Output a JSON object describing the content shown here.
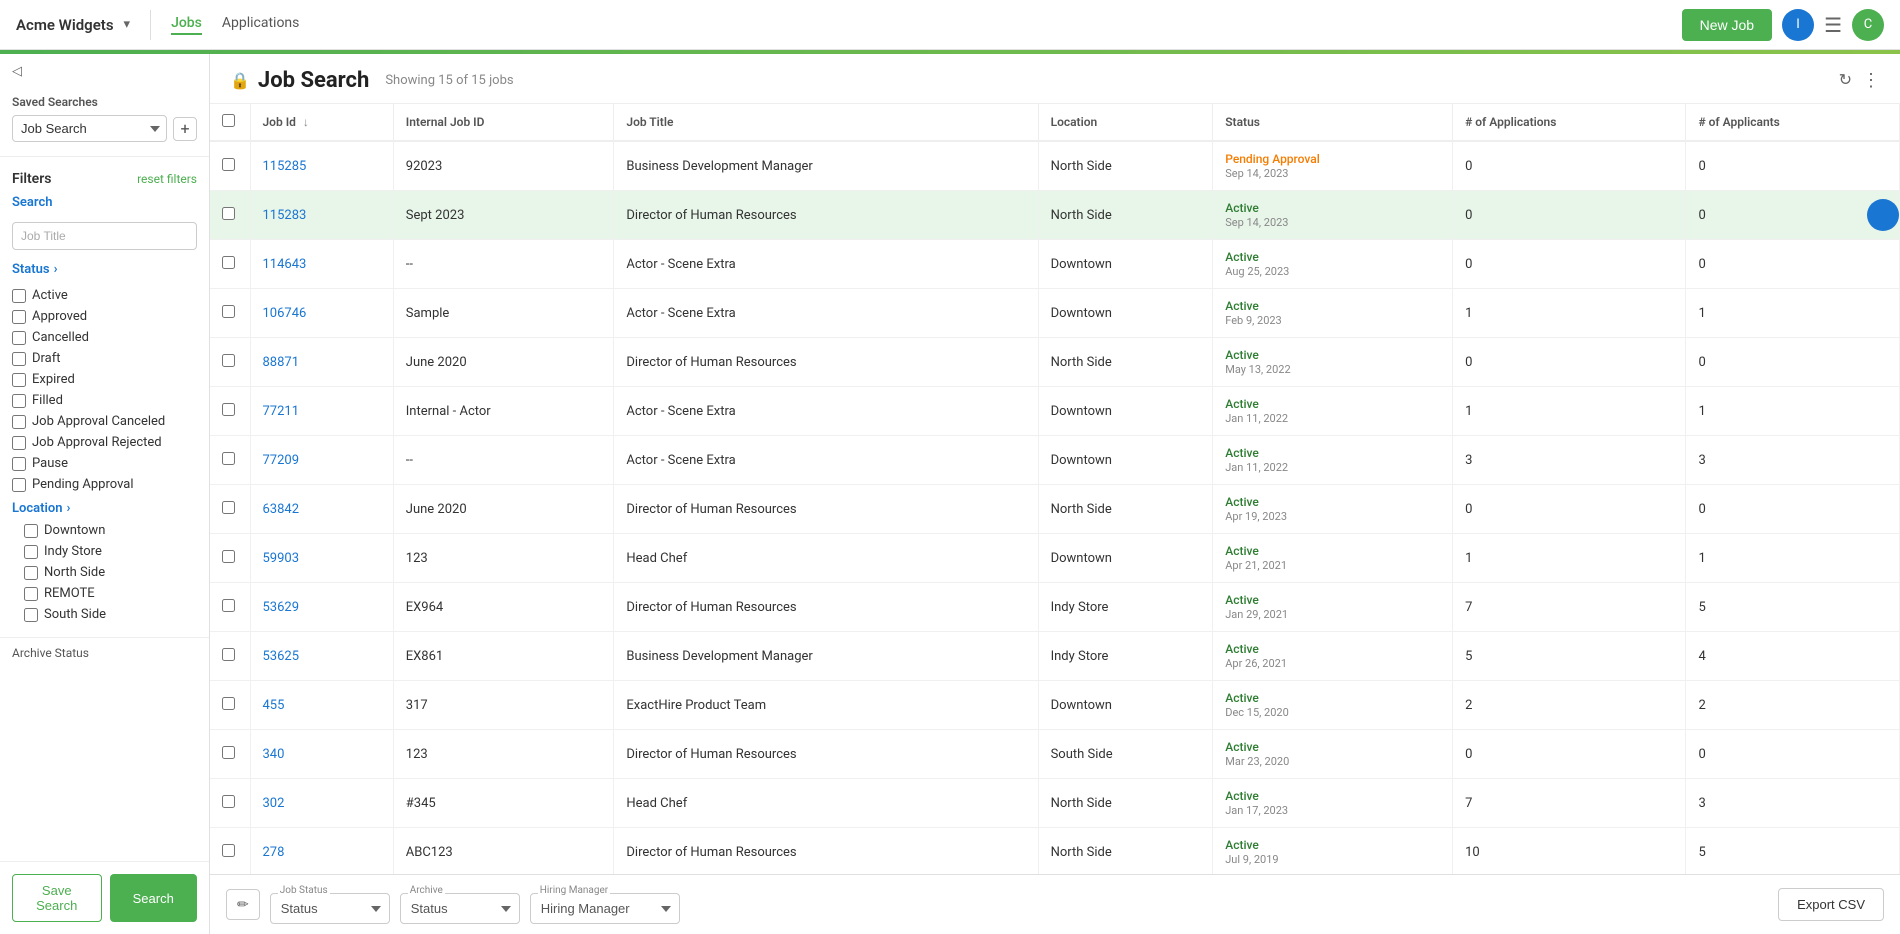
{
  "brand": {
    "name": "Acme Widgets",
    "caret": "▾"
  },
  "nav": {
    "tabs": [
      {
        "id": "jobs",
        "label": "Jobs",
        "active": true
      },
      {
        "id": "applications",
        "label": "Applications",
        "active": false
      }
    ]
  },
  "header_actions": {
    "new_job": "New Job",
    "user_initial_1": "I",
    "user_initial_2": "C"
  },
  "sidebar": {
    "saved_searches_title": "Saved Searches",
    "saved_searches_value": "Job Search",
    "filters_title": "Filters",
    "reset_filters": "reset filters",
    "search_section": {
      "label": "Search",
      "placeholder": "Job Title"
    },
    "status_section": {
      "label": "Status",
      "items": [
        {
          "id": "active",
          "label": "Active"
        },
        {
          "id": "approved",
          "label": "Approved"
        },
        {
          "id": "cancelled",
          "label": "Cancelled"
        },
        {
          "id": "draft",
          "label": "Draft"
        },
        {
          "id": "expired",
          "label": "Expired"
        },
        {
          "id": "filled",
          "label": "Filled"
        },
        {
          "id": "job-approval-canceled",
          "label": "Job Approval Canceled"
        },
        {
          "id": "job-approval-rejected",
          "label": "Job Approval Rejected"
        },
        {
          "id": "pause",
          "label": "Pause"
        },
        {
          "id": "pending-approval",
          "label": "Pending Approval"
        }
      ]
    },
    "location_section": {
      "label": "Location",
      "items": [
        {
          "id": "downtown",
          "label": "Downtown"
        },
        {
          "id": "indy-store",
          "label": "Indy Store"
        },
        {
          "id": "north-side",
          "label": "North Side"
        },
        {
          "id": "remote",
          "label": "REMOTE"
        },
        {
          "id": "south-side",
          "label": "South Side"
        }
      ]
    },
    "archive_status": "Archive Status",
    "save_search_btn": "Save Search",
    "search_btn": "Search"
  },
  "main": {
    "page_title": "Job Search",
    "showing_label": "Showing 15 of 15 jobs",
    "lock_icon": "🔒",
    "table": {
      "columns": [
        {
          "id": "checkbox",
          "label": ""
        },
        {
          "id": "job_id",
          "label": "Job Id",
          "sortable": true
        },
        {
          "id": "internal_job_id",
          "label": "Internal Job ID"
        },
        {
          "id": "job_title",
          "label": "Job Title"
        },
        {
          "id": "location",
          "label": "Location"
        },
        {
          "id": "status",
          "label": "Status"
        },
        {
          "id": "num_applications",
          "label": "# of Applications"
        },
        {
          "id": "num_applicants",
          "label": "# of Applicants"
        }
      ],
      "rows": [
        {
          "job_id": "115285",
          "internal_job_id": "92023",
          "job_title": "Business Development Manager",
          "location": "North Side",
          "status": "Pending Approval",
          "status_date": "Sep 14, 2023",
          "status_type": "pending",
          "num_applications": "0",
          "num_applicants": "0",
          "highlighted": false
        },
        {
          "job_id": "115283",
          "internal_job_id": "Sept 2023",
          "job_title": "Director of Human Resources",
          "location": "North Side",
          "status": "Active",
          "status_date": "Sep 14, 2023",
          "status_type": "active",
          "num_applications": "0",
          "num_applicants": "0",
          "highlighted": true
        },
        {
          "job_id": "114643",
          "internal_job_id": "--",
          "job_title": "Actor - Scene Extra",
          "location": "Downtown",
          "status": "Active",
          "status_date": "Aug 25, 2023",
          "status_type": "active",
          "num_applications": "0",
          "num_applicants": "0",
          "highlighted": false
        },
        {
          "job_id": "106746",
          "internal_job_id": "Sample",
          "job_title": "Actor - Scene Extra",
          "location": "Downtown",
          "status": "Active",
          "status_date": "Feb 9, 2023",
          "status_type": "active",
          "num_applications": "1",
          "num_applicants": "1",
          "highlighted": false
        },
        {
          "job_id": "88871",
          "internal_job_id": "June 2020",
          "job_title": "Director of Human Resources",
          "location": "North Side",
          "status": "Active",
          "status_date": "May 13, 2022",
          "status_type": "active",
          "num_applications": "0",
          "num_applicants": "0",
          "highlighted": false
        },
        {
          "job_id": "77211",
          "internal_job_id": "Internal - Actor",
          "job_title": "Actor - Scene Extra",
          "location": "Downtown",
          "status": "Active",
          "status_date": "Jan 11, 2022",
          "status_type": "active",
          "num_applications": "1",
          "num_applicants": "1",
          "highlighted": false
        },
        {
          "job_id": "77209",
          "internal_job_id": "--",
          "job_title": "Actor - Scene Extra",
          "location": "Downtown",
          "status": "Active",
          "status_date": "Jan 11, 2022",
          "status_type": "active",
          "num_applications": "3",
          "num_applicants": "3",
          "highlighted": false
        },
        {
          "job_id": "63842",
          "internal_job_id": "June 2020",
          "job_title": "Director of Human Resources",
          "location": "North Side",
          "status": "Active",
          "status_date": "Apr 19, 2023",
          "status_type": "active",
          "num_applications": "0",
          "num_applicants": "0",
          "highlighted": false
        },
        {
          "job_id": "59903",
          "internal_job_id": "123",
          "job_title": "Head Chef",
          "location": "Downtown",
          "status": "Active",
          "status_date": "Apr 21, 2021",
          "status_type": "active",
          "num_applications": "1",
          "num_applicants": "1",
          "highlighted": false
        },
        {
          "job_id": "53629",
          "internal_job_id": "EX964",
          "job_title": "Director of Human Resources",
          "location": "Indy Store",
          "status": "Active",
          "status_date": "Jan 29, 2021",
          "status_type": "active",
          "num_applications": "7",
          "num_applicants": "5",
          "highlighted": false
        },
        {
          "job_id": "53625",
          "internal_job_id": "EX861",
          "job_title": "Business Development Manager",
          "location": "Indy Store",
          "status": "Active",
          "status_date": "Apr 26, 2021",
          "status_type": "active",
          "num_applications": "5",
          "num_applicants": "4",
          "highlighted": false
        },
        {
          "job_id": "455",
          "internal_job_id": "317",
          "job_title": "ExactHire Product Team",
          "location": "Downtown",
          "status": "Active",
          "status_date": "Dec 15, 2020",
          "status_type": "active",
          "num_applications": "2",
          "num_applicants": "2",
          "highlighted": false
        },
        {
          "job_id": "340",
          "internal_job_id": "123",
          "job_title": "Director of Human Resources",
          "location": "South Side",
          "status": "Active",
          "status_date": "Mar 23, 2020",
          "status_type": "active",
          "num_applications": "0",
          "num_applicants": "0",
          "highlighted": false
        },
        {
          "job_id": "302",
          "internal_job_id": "#345",
          "job_title": "Head Chef",
          "location": "North Side",
          "status": "Active",
          "status_date": "Jan 17, 2023",
          "status_type": "active",
          "num_applications": "7",
          "num_applicants": "3",
          "highlighted": false
        },
        {
          "job_id": "278",
          "internal_job_id": "ABC123",
          "job_title": "Director of Human Resources",
          "location": "North Side",
          "status": "Active",
          "status_date": "Jul 9, 2019",
          "status_type": "active",
          "num_applications": "10",
          "num_applicants": "5",
          "highlighted": false
        }
      ]
    }
  },
  "bottom_bar": {
    "job_status_label": "Job Status",
    "job_status_placeholder": "Status",
    "archive_label": "Archive",
    "archive_placeholder": "Status",
    "hiring_manager_label": "Hiring Manager",
    "hiring_manager_placeholder": "Hiring Manager",
    "export_csv": "Export CSV"
  }
}
